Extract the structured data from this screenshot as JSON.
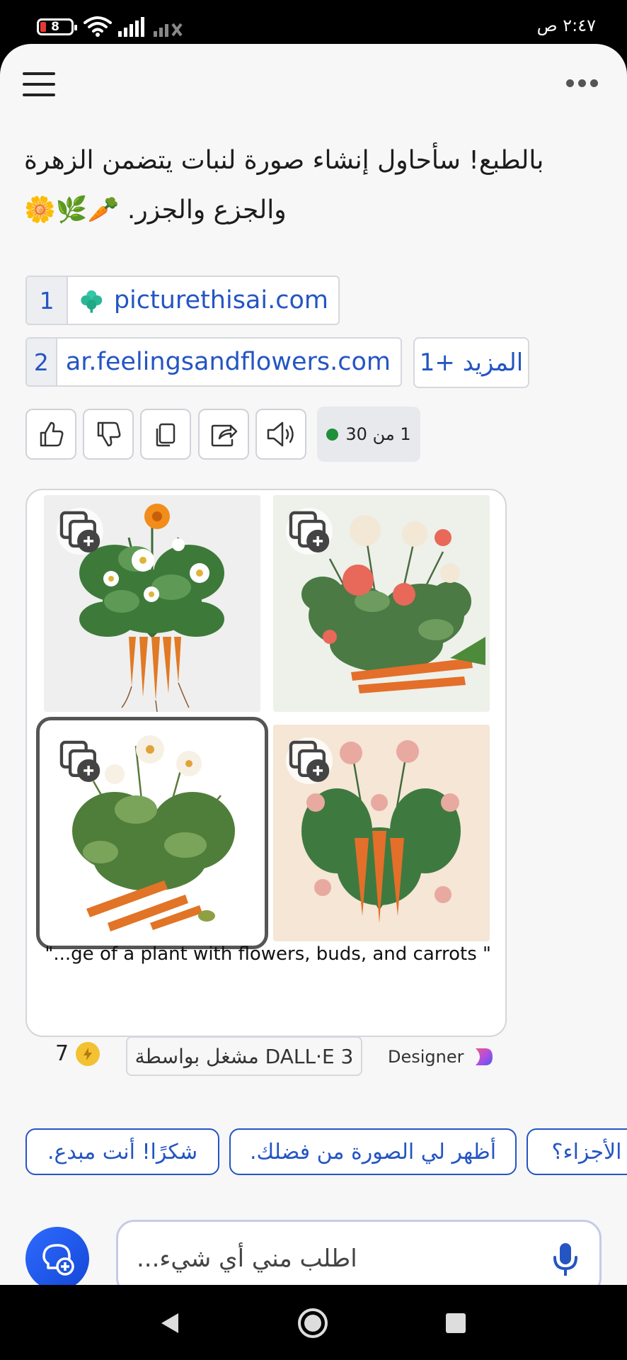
{
  "status_bar": {
    "battery_level": "8",
    "time": "٢:٤٧ ص"
  },
  "message": {
    "text": "بالطبع! سأحاول إنشاء صورة لنبات يتضمن الزهرة والجزع والجزر. 🥕🌿🌼"
  },
  "citations": [
    {
      "number": "1",
      "site": "picturethisai.com"
    },
    {
      "number": "2",
      "site": "ar.feelingsandflowers.com"
    }
  ],
  "citations_more_label": "المزيد +1",
  "actions": {
    "icons": [
      "thumbs-up-icon",
      "thumbs-down-icon",
      "copy-icon",
      "share-icon",
      "speaker-icon"
    ],
    "counter": "1 من 30"
  },
  "image_card": {
    "caption": "\"...ge of a plant with flowers, buds, and carrots \"",
    "boost_count": "7",
    "powered_by": "مشغل بواسطة DALL·E 3",
    "brand": "Designer"
  },
  "suggestions": [
    "شكرًا! أنت مبدع.",
    "أظهر لي الصورة من فضلك.",
    "الأجزاء؟"
  ],
  "input": {
    "placeholder": "اطلب مني أي شيء..."
  },
  "colors": {
    "accent": "#2455c3",
    "background": "#f7f7f8",
    "counter_dot": "#1f8f3a"
  }
}
